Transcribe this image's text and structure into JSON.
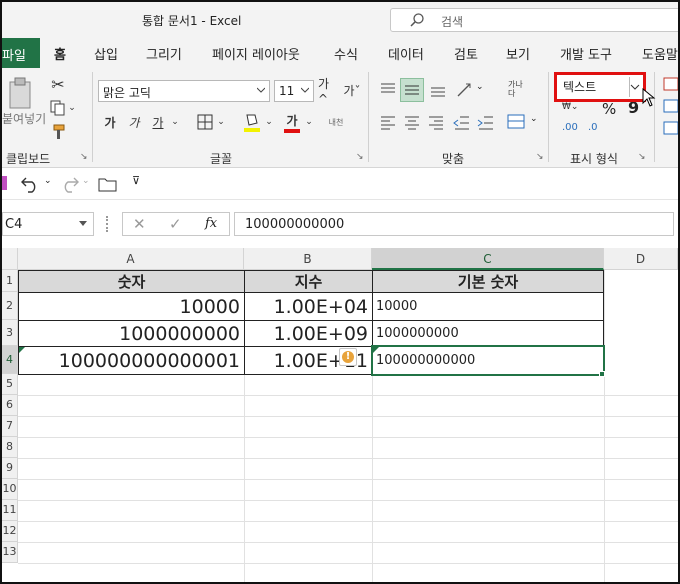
{
  "window": {
    "title": "통합 문서1  -  Excel"
  },
  "search": {
    "placeholder": "검색"
  },
  "ribbon_tabs": [
    "파일",
    "홈",
    "삽입",
    "그리기",
    "페이지 레이아웃",
    "수식",
    "데이터",
    "검토",
    "보기",
    "개발 도구",
    "도움말"
  ],
  "ribbon": {
    "clipboard": {
      "paste_label": "붙여넣기",
      "group_label": "클립보드"
    },
    "font": {
      "name": "맑은 고딕",
      "size": "11",
      "grow": "가^",
      "shrink": "가ˇ",
      "bold": "가",
      "italic": "가",
      "underline": "가",
      "color_letter": "가",
      "phonetic": "내천",
      "group_label": "글꼴"
    },
    "alignment": {
      "wrap": "가나다",
      "group_label": "맞춤"
    },
    "number": {
      "format_value": "텍스트",
      "percent": "%",
      "comma": "9",
      "inc_decimal": ".00",
      "dec_decimal": ".0",
      "group_label": "표시 형식"
    }
  },
  "formula_bar": {
    "name_box": "C4",
    "fx_label": "fx",
    "value": "100000000000"
  },
  "columns": [
    "A",
    "B",
    "C",
    "D"
  ],
  "row_numbers": [
    "1",
    "2",
    "3",
    "4",
    "5",
    "6",
    "7",
    "8",
    "9",
    "10",
    "11",
    "12",
    "13"
  ],
  "table": {
    "headers": [
      "숫자",
      "지수",
      "기본 숫자"
    ],
    "rows": [
      {
        "a": "10000",
        "b": "1.00E+04",
        "c": "10000"
      },
      {
        "a": "1000000000",
        "b": "1.00E+09",
        "c": "1000000000"
      },
      {
        "a": "100000000000001",
        "b": "1.00E+11",
        "c": "100000000000"
      }
    ]
  },
  "colors": {
    "excel_green": "#217346",
    "highlight_red": "#e01010",
    "header_fill": "#d9d9d9"
  }
}
